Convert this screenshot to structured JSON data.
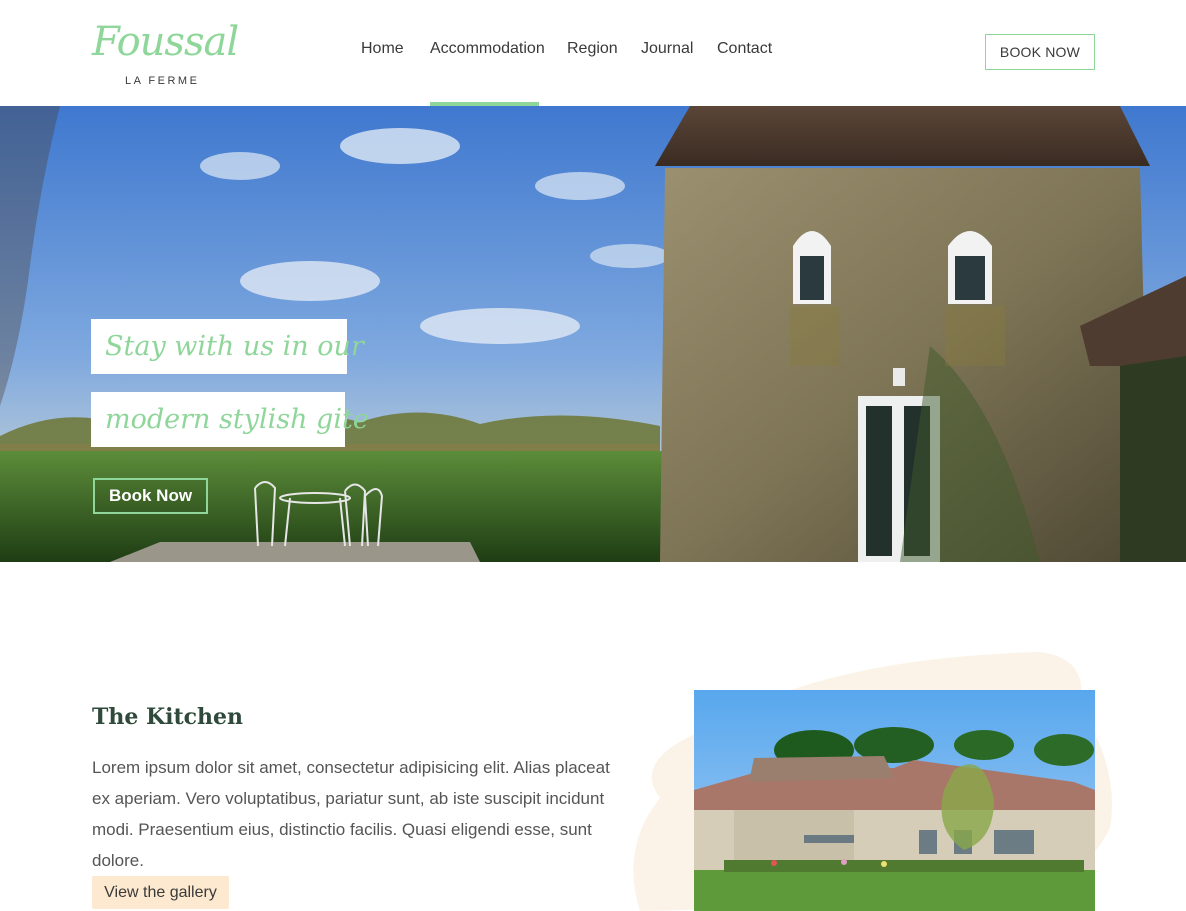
{
  "brand": {
    "script_name": "Foussal",
    "subtitle": "LA FERME"
  },
  "nav": {
    "items": [
      {
        "label": "Home"
      },
      {
        "label": "Accommodation",
        "active": true
      },
      {
        "label": "Region"
      },
      {
        "label": "Journal"
      },
      {
        "label": "Contact"
      }
    ],
    "book_label": "BOOK NOW"
  },
  "hero": {
    "tagline_line1": "Stay with us in our",
    "tagline_line2": "modern stylish gite",
    "button_label": "Book Now"
  },
  "kitchen": {
    "title": "The Kitchen",
    "body": "Lorem ipsum dolor sit amet, consectetur adipisicing elit. Alias placeat ex aperiam. Vero voluptatibus, pariatur sunt, ab iste suscipit incidunt modi. Praesentium eius, distinctio facilis. Quasi eligendi esse, sunt dolore.",
    "button_label": "View the gallery"
  },
  "colors": {
    "accent": "#8fd69a",
    "heading": "#2f4a3a",
    "gallery_button": "#fde9cf"
  }
}
